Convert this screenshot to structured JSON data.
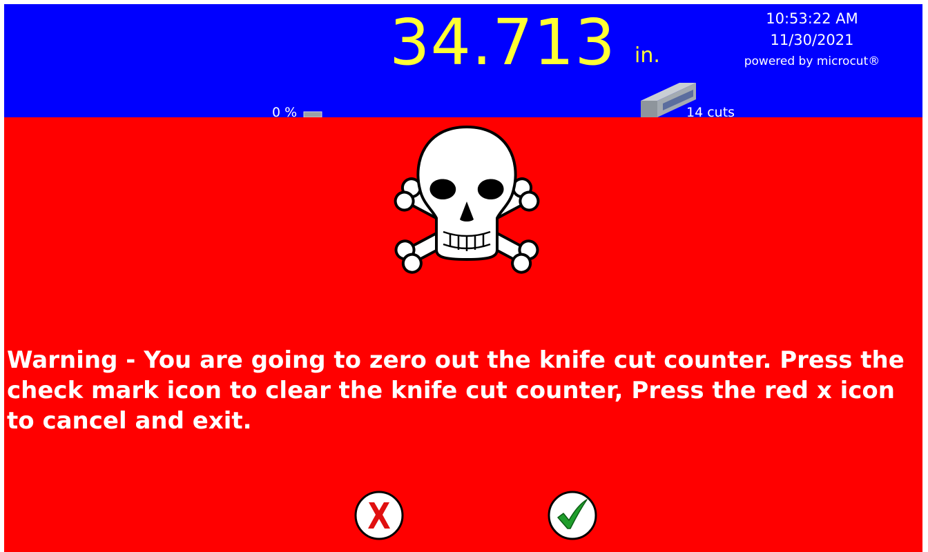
{
  "header": {
    "position_value": "34.713",
    "position_unit": "in.",
    "time": "10:53:22 AM",
    "date": "11/30/2021",
    "powered_by": "powered by microcut®",
    "progress_label": "0 %",
    "cut_count_label": "14 cuts",
    "background_color": "#0000ff",
    "value_color": "#ffff33"
  },
  "warning": {
    "background_color": "#ff0000",
    "icon": "skull-crossbones-icon",
    "message": "Warning - You are going to zero out the knife cut counter. Press the check mark icon to clear the knife cut counter, Press the red x icon to cancel and exit.",
    "cancel_icon": "red-x-icon",
    "confirm_icon": "green-check-icon"
  }
}
